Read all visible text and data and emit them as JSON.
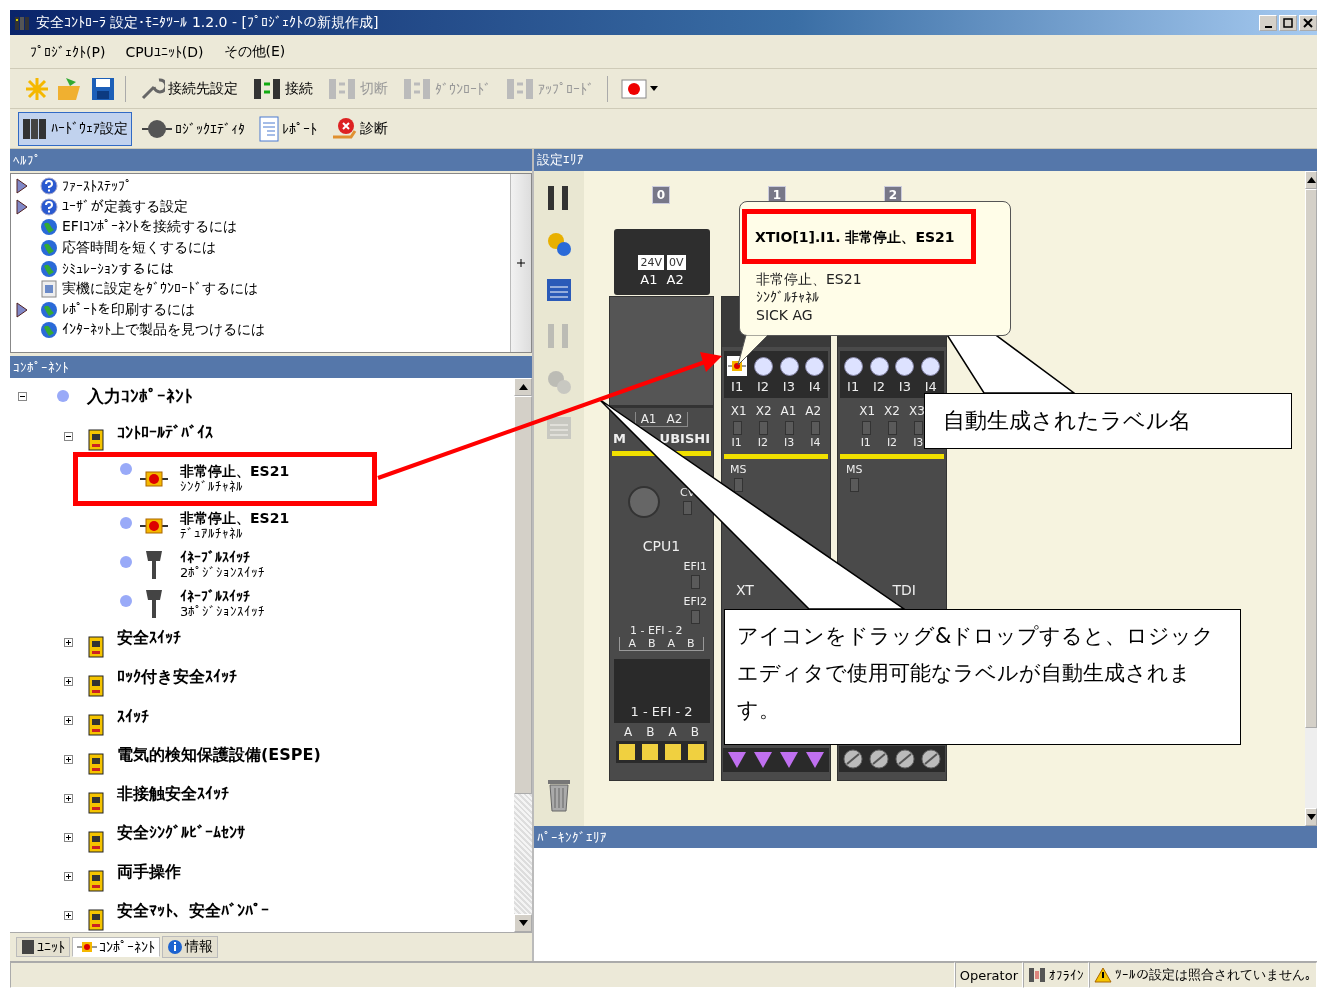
{
  "window": {
    "title": "安全ｺﾝﾄﾛｰﾗ 設定･ﾓﾆﾀﾂｰﾙ 1.2.0 - [ﾌﾟﾛｼﾞｪｸﾄの新規作成]"
  },
  "menu": [
    "ﾌﾟﾛｼﾞｪｸﾄ(P)",
    "CPUﾕﾆｯﾄ(D)",
    "その他(E)"
  ],
  "toolbar": [
    {
      "label": "接続先設定",
      "disabled": false
    },
    {
      "label": "接続",
      "disabled": false
    },
    {
      "label": "切断",
      "disabled": true
    },
    {
      "label": "ﾀﾞｳﾝﾛｰﾄﾞ",
      "disabled": true
    },
    {
      "label": "ｱｯﾌﾟﾛｰﾄﾞ",
      "disabled": true
    }
  ],
  "views": [
    {
      "label": "ﾊｰﾄﾞｳｪｱ設定",
      "selected": true
    },
    {
      "label": "ﾛｼﾞｯｸｴﾃﾞｨﾀ",
      "selected": false
    },
    {
      "label": "ﾚﾎﾟｰﾄ",
      "selected": false
    },
    {
      "label": "診断",
      "selected": false
    }
  ],
  "help": {
    "title": "ﾍﾙﾌﾟ",
    "items": [
      {
        "label": "ﾌｧｰｽﾄｽﾃｯﾌﾟ",
        "kind": "topic",
        "expandable": true
      },
      {
        "label": "ﾕｰｻﾞが定義する設定",
        "kind": "topic",
        "expandable": true
      },
      {
        "label": "EFIｺﾝﾎﾟｰﾈﾝﾄを接続するには",
        "kind": "web",
        "expandable": false
      },
      {
        "label": "応答時間を短くするには",
        "kind": "web",
        "expandable": false
      },
      {
        "label": "ｼﾐｭﾚｰｼｮﾝするには",
        "kind": "web",
        "expandable": false
      },
      {
        "label": "実機に設定をﾀﾞｳﾝﾛｰﾄﾞするには",
        "kind": "video",
        "expandable": false
      },
      {
        "label": "ﾚﾎﾟｰﾄを印刷するには",
        "kind": "web",
        "expandable": true
      },
      {
        "label": "ｲﾝﾀｰﾈｯﾄ上で製品を見つけるには",
        "kind": "web",
        "expandable": false
      }
    ]
  },
  "components": {
    "title": "ｺﾝﾎﾟｰﾈﾝﾄ",
    "tree": [
      {
        "label": "入力ｺﾝﾎﾟｰﾈﾝﾄ",
        "expanded": true,
        "children": [
          {
            "label": "ｺﾝﾄﾛｰﾙﾃﾞﾊﾞｲｽ",
            "expanded": true,
            "children": [
              {
                "label": "非常停止、ES21",
                "sub": "ｼﾝｸﾞﾙﾁｬﾈﾙ",
                "kind": "estop",
                "highlighted": true
              },
              {
                "label": "非常停止、ES21",
                "sub": "ﾃﾞｭｱﾙﾁｬﾈﾙ",
                "kind": "estop",
                "highlighted": false
              },
              {
                "label": "ｲﾈｰﾌﾞﾙｽｲｯﾁ",
                "sub": "2ﾎﾟｼﾞｼｮﾝｽｲｯﾁ",
                "kind": "enable",
                "highlighted": false
              },
              {
                "label": "ｲﾈｰﾌﾞﾙｽｲｯﾁ",
                "sub": "3ﾎﾟｼﾞｼｮﾝｽｲｯﾁ",
                "kind": "enable",
                "highlighted": false
              }
            ]
          },
          {
            "label": "安全ｽｲｯﾁ",
            "expanded": false
          },
          {
            "label": "ﾛｯｸ付き安全ｽｲｯﾁ",
            "expanded": false
          },
          {
            "label": "ｽｲｯﾁ",
            "expanded": false
          },
          {
            "label": "電気的検知保護設備(ESPE)",
            "expanded": false
          },
          {
            "label": "非接触安全ｽｲｯﾁ",
            "expanded": false
          },
          {
            "label": "安全ｼﾝｸﾞﾙﾋﾞｰﾑｾﾝｻ",
            "expanded": false
          },
          {
            "label": "両手操作",
            "expanded": false
          },
          {
            "label": "安全ﾏｯﾄ、安全ﾊﾞﾝﾊﾟｰ",
            "expanded": false
          }
        ]
      }
    ]
  },
  "bottom_tabs": [
    {
      "label": "ﾕﾆｯﾄ",
      "selected": false
    },
    {
      "label": "ｺﾝﾎﾟｰﾈﾝﾄ",
      "selected": true
    },
    {
      "label": "情報",
      "selected": false
    }
  ],
  "settings_area": {
    "title": "設定ｴﾘｱ",
    "tools": [
      {
        "disabled": false
      },
      {
        "disabled": false
      },
      {
        "disabled": false
      },
      {
        "disabled": true
      },
      {
        "disabled": true
      },
      {
        "disabled": true
      }
    ],
    "slots": [
      "0",
      "1",
      "2"
    ],
    "power": {
      "voltages": [
        "24V",
        "0V"
      ],
      "terminals": [
        "A1",
        "A2"
      ]
    },
    "cpu": {
      "terminals": [
        "A1",
        "A2"
      ],
      "brand_parts": [
        "M",
        "UBISHI"
      ],
      "cv": "CV",
      "name": "CPU1",
      "efi_leds": [
        "EFI1",
        "EFI2"
      ],
      "efi_label": "1 - EFI - 2",
      "efi_terminals": [
        "A",
        "B",
        "A",
        "B"
      ],
      "display": "1 - EFI - 2",
      "bottom_terminals": [
        "A",
        "B",
        "A",
        "B"
      ]
    },
    "io_modules": [
      {
        "top_terminals": [
          "X1",
          "X2",
          "A1",
          "A2"
        ],
        "inputs": [
          {
            "label": "I1",
            "assigned": true
          },
          {
            "label": "I2",
            "assigned": false
          },
          {
            "label": "I3",
            "assigned": false
          },
          {
            "label": "I4",
            "assigned": false
          }
        ],
        "led_labels": [
          "I1",
          "I2",
          "I3",
          "I4"
        ],
        "status": "MS",
        "name": "XT",
        "kind": "output"
      },
      {
        "top_terminals": [
          "X1",
          "X2",
          "X3"
        ],
        "inputs": [
          {
            "label": "I1",
            "assigned": false
          },
          {
            "label": "I2",
            "assigned": false
          },
          {
            "label": "I3",
            "assigned": false
          },
          {
            "label": "I4",
            "assigned": false
          }
        ],
        "led_labels": [
          "I1",
          "I2",
          "I3"
        ],
        "status": "MS",
        "name": "TDI",
        "kind": "input"
      }
    ],
    "tooltip": {
      "title": "XTIO[1].I1. 非常停止、ES21",
      "lines": [
        "非常停止、ES21",
        "ｼﾝｸﾞﾙﾁｬﾈﾙ",
        "SICK AG"
      ]
    },
    "callouts": [
      "自動生成されたラベル名",
      "アイコンをドラッグ&ドロップすると、ロジックエディタで使用可能なラベルが自動生成されます。"
    ]
  },
  "parking_area": {
    "title": "ﾊﾟｰｷﾝｸﾞｴﾘｱ"
  },
  "status_bar": {
    "user": "Operator",
    "connection": "ｵﾌﾗｲﾝ",
    "message": "ﾂｰﾙの設定は照合されていません｡"
  }
}
